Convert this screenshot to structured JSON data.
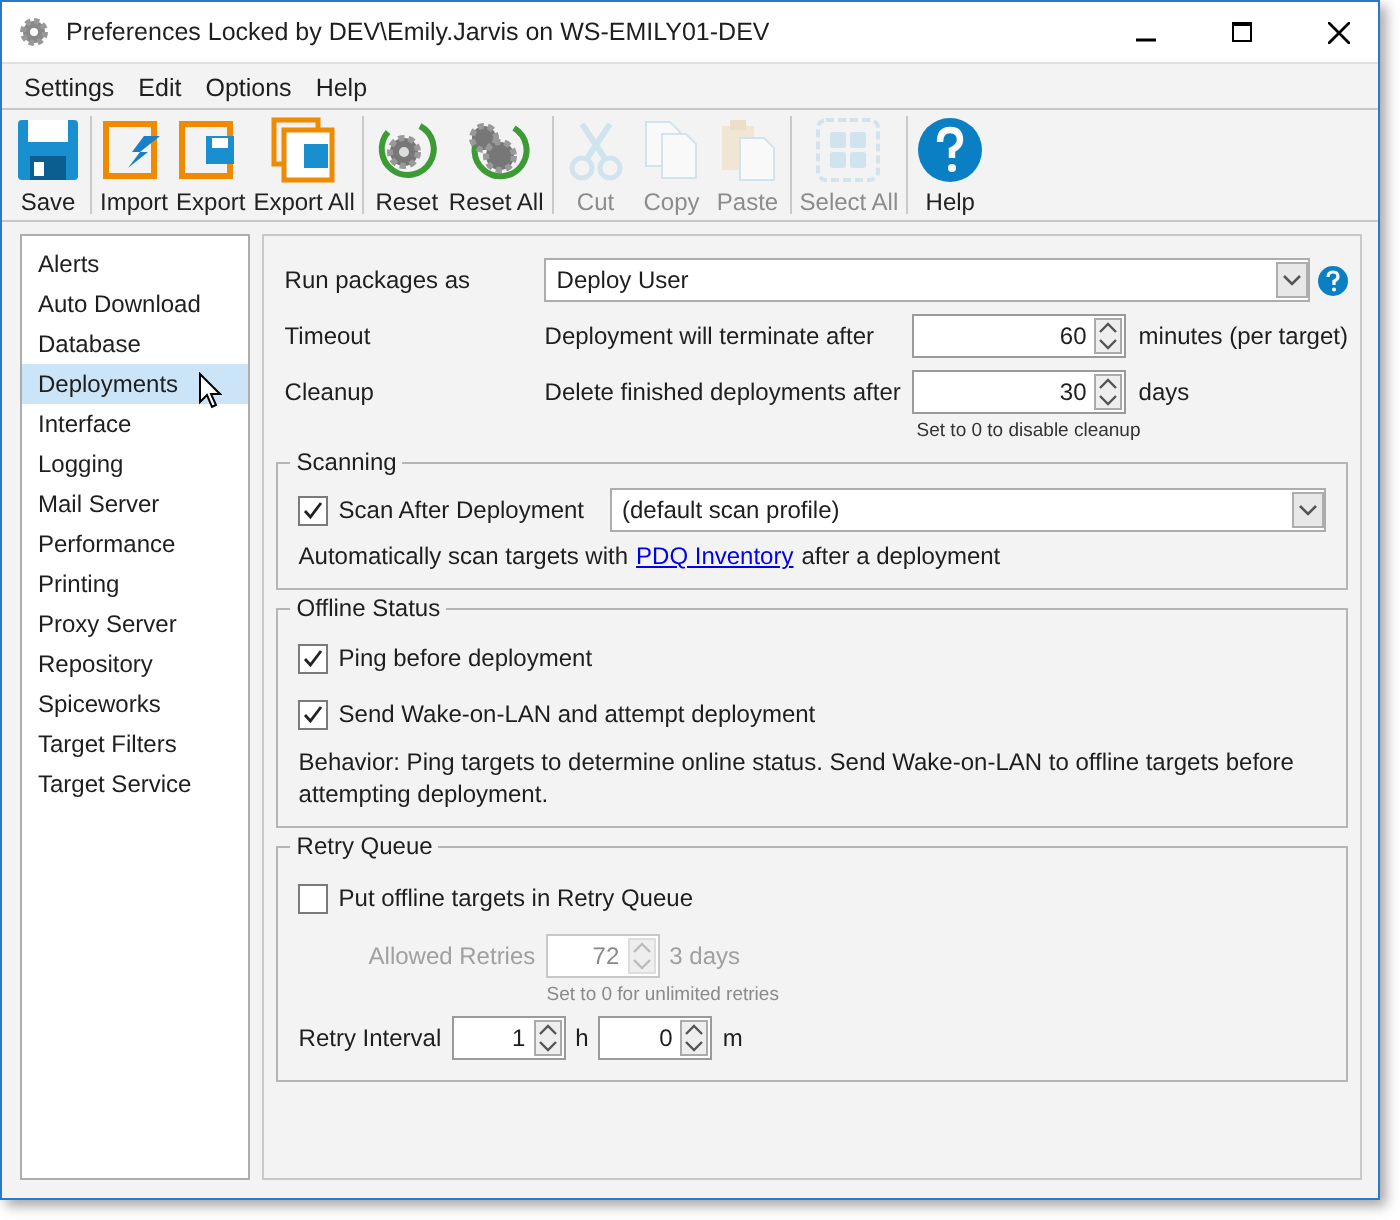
{
  "window": {
    "title": "Preferences Locked by DEV\\Emily.Jarvis on WS-EMILY01-DEV"
  },
  "menu": [
    "Settings",
    "Edit",
    "Options",
    "Help"
  ],
  "toolbar": [
    [
      {
        "kind": "save",
        "label": "Save",
        "disabled": false
      }
    ],
    [
      {
        "kind": "import",
        "label": "Import",
        "disabled": false
      },
      {
        "kind": "export",
        "label": "Export",
        "disabled": false
      },
      {
        "kind": "export-all",
        "label": "Export All",
        "disabled": false
      }
    ],
    [
      {
        "kind": "reset",
        "label": "Reset",
        "disabled": false
      },
      {
        "kind": "reset-all",
        "label": "Reset All",
        "disabled": false
      }
    ],
    [
      {
        "kind": "cut",
        "label": "Cut",
        "disabled": true
      },
      {
        "kind": "copy",
        "label": "Copy",
        "disabled": true
      },
      {
        "kind": "paste",
        "label": "Paste",
        "disabled": true
      }
    ],
    [
      {
        "kind": "select-all",
        "label": "Select All",
        "disabled": true
      }
    ],
    [
      {
        "kind": "help",
        "label": "Help",
        "disabled": false
      }
    ]
  ],
  "sidebar": {
    "items": [
      {
        "label": "Alerts",
        "selected": false
      },
      {
        "label": "Auto Download",
        "selected": false
      },
      {
        "label": "Database",
        "selected": false
      },
      {
        "label": "Deployments",
        "selected": true
      },
      {
        "label": "Interface",
        "selected": false
      },
      {
        "label": "Logging",
        "selected": false
      },
      {
        "label": "Mail Server",
        "selected": false
      },
      {
        "label": "Performance",
        "selected": false
      },
      {
        "label": "Printing",
        "selected": false
      },
      {
        "label": "Proxy Server",
        "selected": false
      },
      {
        "label": "Repository",
        "selected": false
      },
      {
        "label": "Spiceworks",
        "selected": false
      },
      {
        "label": "Target Filters",
        "selected": false
      },
      {
        "label": "Target Service",
        "selected": false
      }
    ]
  },
  "settings": {
    "run_as": {
      "label": "Run packages as",
      "value": "Deploy User"
    },
    "timeout": {
      "label": "Timeout",
      "text": "Deployment will terminate after",
      "value": "60",
      "unit": "minutes (per target)"
    },
    "cleanup": {
      "label": "Cleanup",
      "text": "Delete finished deployments after",
      "value": "30",
      "unit": "days",
      "hint": "Set to 0 to disable cleanup"
    }
  },
  "scanning": {
    "title": "Scanning",
    "checkbox": {
      "label": "Scan After Deployment",
      "checked": true
    },
    "profile": "(default scan profile)",
    "text_before": "Automatically scan targets with",
    "link": "PDQ Inventory",
    "text_after": "after a deployment"
  },
  "offline_status": {
    "title": "Offline Status",
    "checkboxes": [
      {
        "label": "Ping before deployment",
        "checked": true
      },
      {
        "label": "Send Wake-on-LAN and attempt deployment",
        "checked": true
      }
    ],
    "behavior": "Behavior: Ping targets to determine online status. Send Wake-on-LAN to offline targets before attempting deployment."
  },
  "retry_queue": {
    "title": "Retry Queue",
    "checkbox": {
      "label": "Put offline targets in Retry Queue",
      "checked": false
    },
    "allowed_retries": {
      "label": "Allowed Retries",
      "value": "72",
      "unit": "3 days",
      "disabled": true
    },
    "hint": "Set to 0 for unlimited retries",
    "interval": {
      "label": "Retry Interval",
      "hours": "1",
      "hours_unit": "h",
      "minutes": "0",
      "minutes_unit": "m"
    }
  }
}
